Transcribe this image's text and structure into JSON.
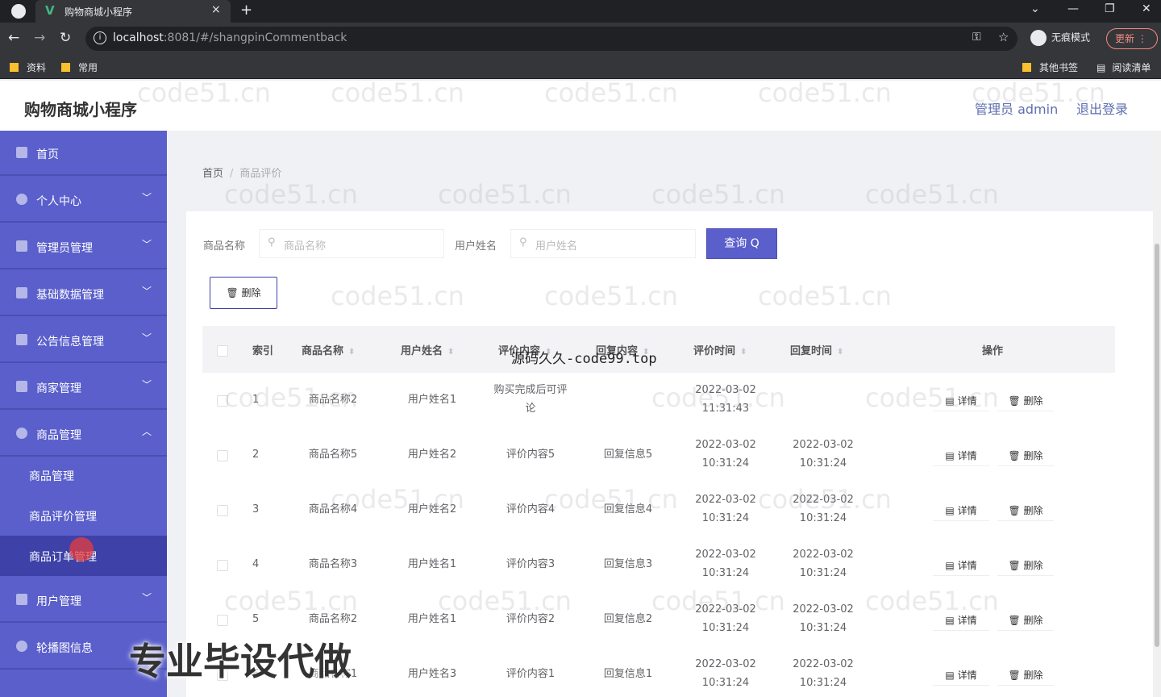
{
  "browser": {
    "tab_title": "购物商城小程序",
    "tab_close": "×",
    "new_tab": "+",
    "url_host": "localhost",
    "url_path": ":8081/#/shangpinCommentback",
    "incognito": "无痕模式",
    "update": "更新 ⋮",
    "bookmarks": [
      "资料",
      "常用"
    ],
    "bookmarks_right": [
      "其他书签",
      "阅读清单"
    ]
  },
  "header": {
    "title": "购物商城小程序",
    "admin": "管理员 admin",
    "logout": "退出登录"
  },
  "sidebar": {
    "items": [
      {
        "label": "首页",
        "arrow": ""
      },
      {
        "label": "个人中心",
        "arrow": "﹀"
      },
      {
        "label": "管理员管理",
        "arrow": "﹀"
      },
      {
        "label": "基础数据管理",
        "arrow": "﹀"
      },
      {
        "label": "公告信息管理",
        "arrow": "﹀"
      },
      {
        "label": "商家管理",
        "arrow": "﹀"
      },
      {
        "label": "商品管理",
        "arrow": "︿"
      }
    ],
    "sub_items": [
      "商品管理",
      "商品评价管理",
      "商品订单管理"
    ],
    "bottom_items": [
      {
        "label": "用户管理",
        "arrow": "﹀"
      },
      {
        "label": "轮播图信息",
        "arrow": ""
      }
    ]
  },
  "breadcrumb": {
    "home": "首页",
    "sep": "/",
    "current": "商品评价"
  },
  "search": {
    "goods_label": "商品名称",
    "goods_placeholder": "商品名称",
    "user_label": "用户姓名",
    "user_placeholder": "用户姓名",
    "query_btn": "查询 Q",
    "delete_btn": "🗑 删除"
  },
  "table": {
    "headers": [
      "索引",
      "商品名称",
      "用户姓名",
      "评价内容",
      "回复内容",
      "评价时间",
      "回复时间",
      "操作"
    ],
    "sort_icon": "⬍",
    "rows": [
      {
        "idx": "1",
        "goods": "商品名称2",
        "user": "用户姓名1",
        "content": "购买完成后可评论",
        "reply": "",
        "time": "2022-03-02 11:31:43",
        "reply_time": ""
      },
      {
        "idx": "2",
        "goods": "商品名称5",
        "user": "用户姓名2",
        "content": "评价内容5",
        "reply": "回复信息5",
        "time": "2022-03-02 10:31:24",
        "reply_time": "2022-03-02 10:31:24"
      },
      {
        "idx": "3",
        "goods": "商品名称4",
        "user": "用户姓名2",
        "content": "评价内容4",
        "reply": "回复信息4",
        "time": "2022-03-02 10:31:24",
        "reply_time": "2022-03-02 10:31:24"
      },
      {
        "idx": "4",
        "goods": "商品名称3",
        "user": "用户姓名1",
        "content": "评价内容3",
        "reply": "回复信息3",
        "time": "2022-03-02 10:31:24",
        "reply_time": "2022-03-02 10:31:24"
      },
      {
        "idx": "5",
        "goods": "商品名称2",
        "user": "用户姓名1",
        "content": "评价内容2",
        "reply": "回复信息2",
        "time": "2022-03-02 10:31:24",
        "reply_time": "2022-03-02 10:31:24"
      },
      {
        "idx": "6",
        "goods": "商品名称1",
        "user": "用户姓名3",
        "content": "评价内容1",
        "reply": "回复信息1",
        "time": "2022-03-02 10:31:24",
        "reply_time": "2022-03-02 10:31:24"
      }
    ],
    "detail_btn": "▤ 详情",
    "delete_btn": "🗑 删除"
  },
  "overlay": {
    "watermark": "code51.cn",
    "source": "源码久久-code99.top",
    "promo": "专业毕设代做"
  }
}
